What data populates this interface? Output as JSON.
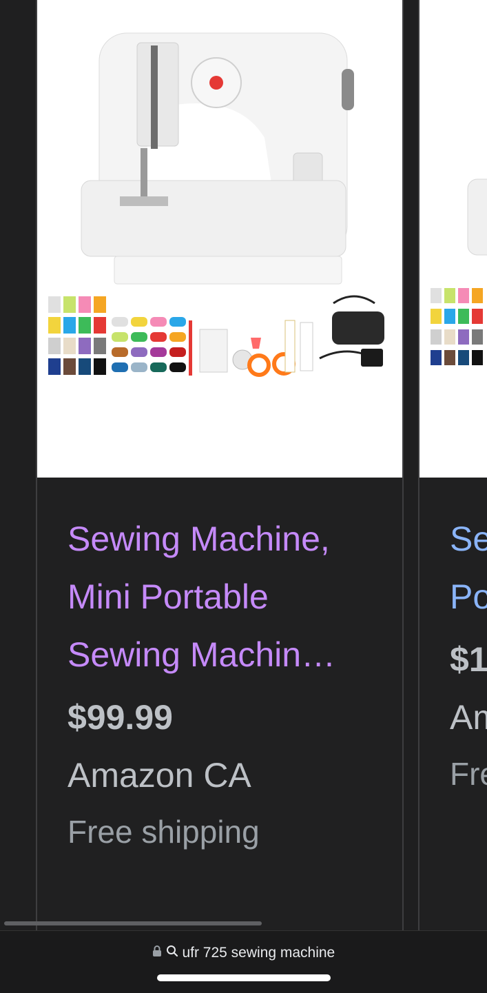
{
  "results": [
    {
      "title": "Sewing Machine, Mini Portable Sewing Machin…",
      "price": "$99.99",
      "seller": "Amazon CA",
      "shipping": "Free shipping"
    },
    {
      "title": "Sewing Machine, Mini Portable Sewing Machine",
      "price": "$1",
      "seller": "Amazon CA",
      "shipping": "Free shipping"
    }
  ],
  "address_bar": {
    "query": "ufr 725 sewing machine",
    "lock_icon": "lock-icon",
    "search_icon": "search-icon"
  },
  "colors": {
    "title_visited": "#c58af9",
    "title_link": "#8ab4f8",
    "background": "#1f1f20"
  }
}
